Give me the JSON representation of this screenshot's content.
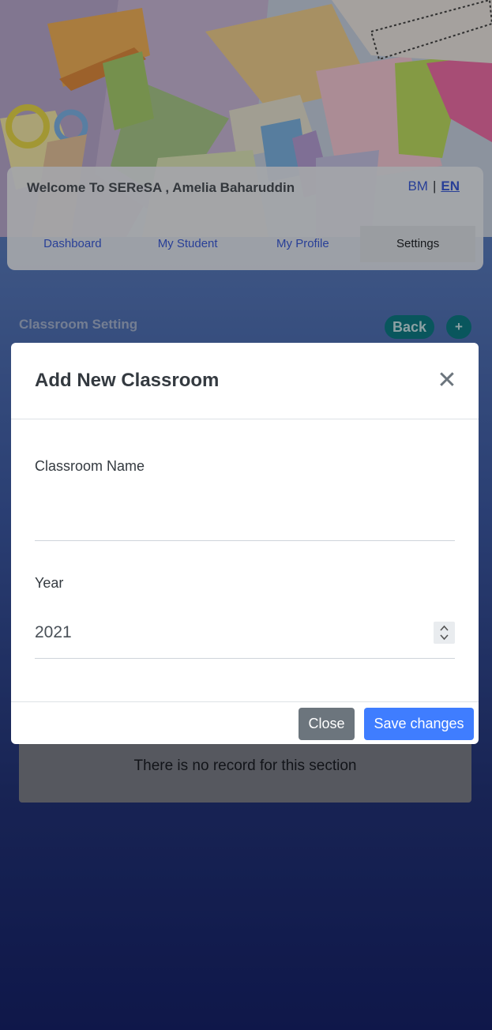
{
  "header": {
    "welcome_text": "Welcome To SEReSA , Amelia Baharuddin",
    "lang_bm": "BM",
    "lang_separator": "|",
    "lang_en": "EN"
  },
  "nav": {
    "tabs": [
      {
        "label": "Dashboard",
        "active": false
      },
      {
        "label": "My Student",
        "active": false
      },
      {
        "label": "My Profile",
        "active": false
      },
      {
        "label": "Settings",
        "active": true
      }
    ]
  },
  "classroom_section": {
    "title": "Classroom Setting",
    "back_label": "Back",
    "add_label": "+",
    "empty_message": "There is no record for this section"
  },
  "modal": {
    "title": "Add New Classroom",
    "close_icon": "close-icon",
    "fields": {
      "classroom_name_label": "Classroom Name",
      "classroom_name_value": "",
      "year_label": "Year",
      "year_value": "2021"
    },
    "buttons": {
      "close_label": "Close",
      "save_label": "Save changes"
    }
  },
  "colors": {
    "primary": "#3f7dff",
    "secondary": "#6c757d",
    "teal": "#0e7c86",
    "link": "#3a5bd9"
  }
}
